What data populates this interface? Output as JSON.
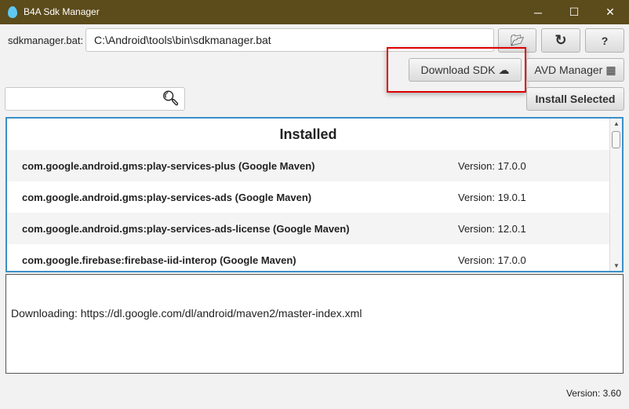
{
  "window": {
    "title": "B4A Sdk Manager",
    "minimize": "─",
    "maximize": "☐",
    "close": "✕"
  },
  "toolbar": {
    "path_label": "sdkmanager.bat:",
    "path_value": "C:\\Android\\tools\\bin\\sdkmanager.bat",
    "download_sdk": "Download SDK",
    "avd_manager": "AVD Manager",
    "install_selected": "Install Selected",
    "help": "?"
  },
  "list": {
    "header": "Installed",
    "items": [
      {
        "name": "com.google.android.gms:play-services-plus (Google Maven)",
        "version": "Version: 17.0.0"
      },
      {
        "name": "com.google.android.gms:play-services-ads (Google Maven)",
        "version": "Version: 19.0.1"
      },
      {
        "name": "com.google.android.gms:play-services-ads-license (Google Maven)",
        "version": "Version: 12.0.1"
      },
      {
        "name": "com.google.firebase:firebase-iid-interop (Google Maven)",
        "version": "Version: 17.0.0"
      }
    ]
  },
  "log": {
    "text": "Downloading: https://dl.google.com/dl/android/maven2/master-index.xml"
  },
  "footer": {
    "version": "Version: 3.60"
  },
  "colors": {
    "titlebar": "#5c4b1b",
    "highlight": "#e00000",
    "list_border": "#3c8fc8"
  }
}
